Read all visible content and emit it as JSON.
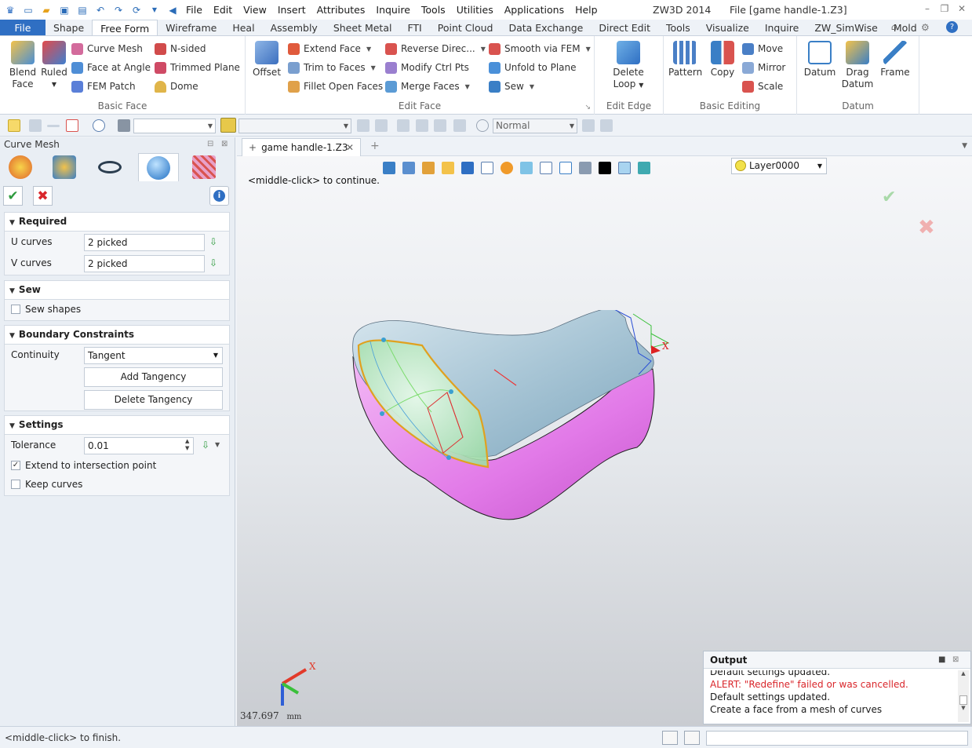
{
  "app": {
    "name": "ZW3D 2014",
    "file_title": "File [game handle-1.Z3]"
  },
  "menu": [
    "File",
    "Edit",
    "View",
    "Insert",
    "Attributes",
    "Inquire",
    "Tools",
    "Utilities",
    "Applications",
    "Help"
  ],
  "ribbon_tabs": [
    "File",
    "Shape",
    "Free Form",
    "Wireframe",
    "Heal",
    "Assembly",
    "Sheet Metal",
    "FTI",
    "Point Cloud",
    "Data Exchange",
    "Direct Edit",
    "Tools",
    "Visualize",
    "Inquire",
    "ZW_SimWise",
    "Mold"
  ],
  "active_ribbon_tab": "Free Form",
  "ribbon": {
    "basic_face": {
      "label": "Basic Face",
      "blend_face": "Blend Face",
      "ruled": "Ruled",
      "curve_mesh": "Curve Mesh",
      "face_at_angle": "Face at Angle",
      "fem_patch": "FEM Patch",
      "n_sided": "N-sided",
      "trimmed_plane": "Trimmed Plane",
      "dome": "Dome"
    },
    "edit_face": {
      "label": "Edit Face",
      "offset": "Offset",
      "extend_face": "Extend Face",
      "trim_to_faces": "Trim to Faces",
      "fillet_open_faces": "Fillet Open Faces",
      "reverse_direction": "Reverse Direc...",
      "modify_ctrl_pts": "Modify Ctrl Pts",
      "merge_faces": "Merge Faces",
      "smooth_via_fem": "Smooth via FEM",
      "unfold_to_plane": "Unfold to Plane",
      "sew": "Sew"
    },
    "edit_edge": {
      "label": "Edit Edge",
      "delete_loop": "Delete Loop"
    },
    "basic_editing": {
      "label": "Basic Editing",
      "pattern": "Pattern",
      "copy": "Copy",
      "move": "Move",
      "mirror": "Mirror",
      "scale": "Scale"
    },
    "datum": {
      "label": "Datum",
      "datum": "Datum",
      "drag_datum": "Drag Datum",
      "frame": "Frame"
    }
  },
  "toolbar": {
    "filter_value": "",
    "style_value": "Normal"
  },
  "panel": {
    "title": "Curve Mesh",
    "required": {
      "header": "Required",
      "u_label": "U curves",
      "u_value": "2 picked",
      "v_label": "V curves",
      "v_value": "2 picked"
    },
    "sew": {
      "header": "Sew",
      "sew_shapes": "Sew shapes",
      "sew_shapes_checked": false
    },
    "boundary": {
      "header": "Boundary Constraints",
      "continuity_label": "Continuity",
      "continuity_value": "Tangent",
      "add_tangency": "Add Tangency",
      "delete_tangency": "Delete Tangency"
    },
    "settings": {
      "header": "Settings",
      "tolerance_label": "Tolerance",
      "tolerance_value": "0.01",
      "extend_label": "Extend to intersection point",
      "extend_checked": true,
      "keep_curves_label": "Keep curves",
      "keep_curves_checked": false
    }
  },
  "viewport": {
    "doc_tab": "game handle-1.Z3",
    "layer": "Layer0000",
    "prompt": "<middle-click> to continue.",
    "axis_label": "X",
    "coord_readout": "347.697",
    "coord_unit": "mm"
  },
  "output": {
    "title": "Output",
    "lines": [
      {
        "text": "Default settings updated.",
        "alert": false
      },
      {
        "text": "ALERT: \"Redefine\" failed or was cancelled.",
        "alert": true
      },
      {
        "text": "Default settings updated.",
        "alert": false
      },
      {
        "text": "Create a face from a mesh of curves",
        "alert": false
      }
    ]
  },
  "status": {
    "text": "<middle-click> to finish."
  },
  "colors": {
    "accent": "#2f6fc3",
    "alert": "#d9262b",
    "model_top": "#9fc0d0",
    "model_side": "#e27ae8",
    "patch": "#9fe0a8"
  }
}
